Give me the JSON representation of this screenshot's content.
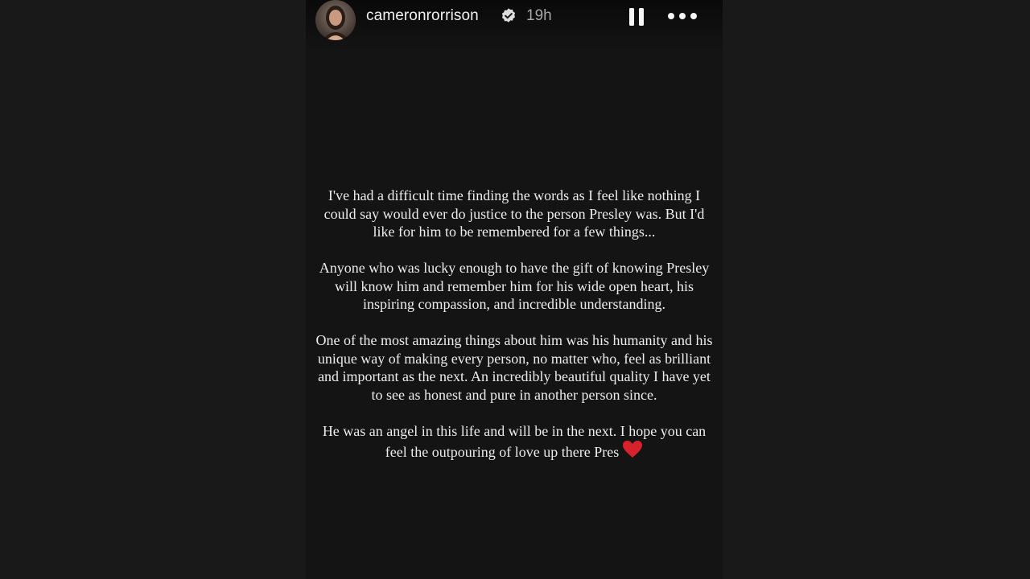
{
  "story": {
    "username": "cameronrorrison",
    "timestamp": "19h",
    "paragraph1": "I've had a difficult time finding the words as I feel like nothing I could say would ever do justice to the person Presley was. But I'd like for him to be remembered for a few things...",
    "paragraph2": "Anyone who was lucky enough to have the gift of knowing Presley will know him and remember him for his wide open heart, his inspiring compassion, and incredible understanding.",
    "paragraph3": "One of the most amazing things about him was his humanity and his unique way of making every person, no matter who, feel as brilliant and important as the next. An incredibly beautiful quality I have yet to see as honest and pure in another person since.",
    "paragraph4": "He was an angel in this life and will be in the next. I hope you can feel the outpouring of love up there Pres",
    "heart_emoji_color": "#d7222b"
  },
  "icons": {
    "verified": "verified-badge-icon",
    "pause": "pause-icon",
    "more": "more-options-icon"
  },
  "colors": {
    "background": "#191919",
    "story_background": "#141414",
    "text": "#ededed",
    "timestamp": "#a8a8a8"
  }
}
